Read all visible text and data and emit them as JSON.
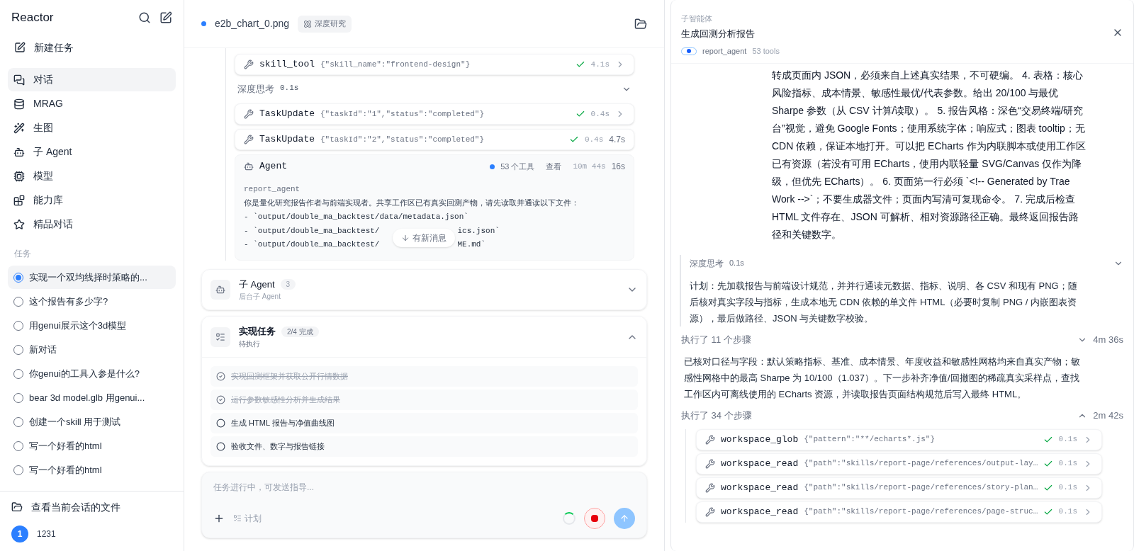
{
  "sidebar": {
    "brand": "Reactor",
    "new_task": "新建任务",
    "nav": [
      {
        "label": "对话",
        "kind": "chat",
        "selected": true
      },
      {
        "label": "MRAG",
        "kind": "database",
        "selected": false
      },
      {
        "label": "生图",
        "kind": "image",
        "selected": false
      },
      {
        "label": "子 Agent",
        "kind": "agent",
        "selected": false
      },
      {
        "label": "模型",
        "kind": "model",
        "selected": false
      },
      {
        "label": "能力库",
        "kind": "library",
        "selected": false
      },
      {
        "label": "精品对话",
        "kind": "featured",
        "selected": false
      }
    ],
    "tasks_heading": "任务",
    "tasks": [
      {
        "label": "实现一个双均线择时策略的...",
        "selected": true
      },
      {
        "label": "这个报告有多少字?",
        "selected": false
      },
      {
        "label": "用genui展示这个3d模型",
        "selected": false
      },
      {
        "label": "新对话",
        "selected": false
      },
      {
        "label": "你genui的工具入参是什么?",
        "selected": false
      },
      {
        "label": "bear 3d model.glb 用genui...",
        "selected": false
      },
      {
        "label": "创建一个skill 用于测试",
        "selected": false
      },
      {
        "label": "写一个好看的html",
        "selected": false
      },
      {
        "label": "写一个好看的html",
        "selected": false
      }
    ],
    "files_link": "查看当前会话的文件",
    "user": {
      "initial": "1",
      "name": "1231"
    }
  },
  "main": {
    "file": "e2b_chart_0.png",
    "mode_badge": "深度研究",
    "stream": [
      {
        "kind": "tool",
        "name": "skill_tool",
        "args": "{\"skill_name\":\"frontend-design\"}",
        "duration": "4.1s"
      },
      {
        "kind": "thinking",
        "label": "深度思考",
        "duration": "0.1s",
        "expanded": false
      },
      {
        "kind": "tool",
        "name": "TaskUpdate",
        "args": "{\"taskId\":\"1\",\"status\":\"completed\"}",
        "duration": "0.4s"
      },
      {
        "kind": "tool",
        "name": "TaskUpdate",
        "args": "{\"taskId\":\"2\",\"status\":\"completed\"}",
        "duration": "0.4s",
        "overlay": "4.7s"
      }
    ],
    "agent": {
      "title": "Agent",
      "tools": "53 个工具",
      "view": "查看",
      "elapsed": "10m 44s",
      "overlay": "16s",
      "agent_name": "report_agent",
      "prompt": "你是量化研究报告作者与前端实现者。共享工作区已有真实回测产物，请先读取并通读以下文件：",
      "lines": [
        {
          "before": "- `output/double_ma_backtest/data/metadata.json`"
        },
        {
          "before": "- `output/double_ma_backtest/",
          "after": "ics.json`"
        },
        {
          "before": "- `output/double_ma_backtest/",
          "after": "ME.md`"
        }
      ]
    },
    "new_messages": "有新消息",
    "subagents": {
      "title": "子 Agent",
      "count": "3",
      "subtitle": "后台子 Agent",
      "expanded": false
    },
    "todo": {
      "title": "实现任务",
      "progress": "2/4 完成",
      "subtitle": "待执行",
      "expanded": true,
      "items": [
        {
          "label": "实现回测框架并获取公开行情数据",
          "done": true
        },
        {
          "label": "运行参数敏感性分析并生成结果",
          "done": true
        },
        {
          "label": "生成 HTML 报告与净值曲线图",
          "done": false
        },
        {
          "label": "验收文件、数字与报告链接",
          "done": false
        }
      ]
    },
    "composer": {
      "placeholder": "任务进行中，可发送指导...",
      "plan": "计划"
    }
  },
  "panel": {
    "label": "子智能体",
    "title": "生成回测分析报告",
    "toggle_on": true,
    "agent": "report_agent",
    "tools": "53 tools",
    "message": "转成页面内 JSON，必须来自上述真实结果，不可硬编。 4. 表格：核心风险指标、成本情景、敏感性最优/代表参数。给出 20/100 与最优 Sharpe 参数（从 CSV 计算/读取）。 5. 报告风格：深色“交易终端/研究台”视觉，避免 Google Fonts；使用系统字体；响应式；图表 tooltip；无 CDN 依赖，保证本地打开。可以把 ECharts 作为内联脚本或使用工作区已有资源（若没有可用 ECharts，使用内联轻量 SVG/Canvas 仅作为降级，但优先 ECharts）。 6. 页面第一行必须 `<!-- Generated by Trae Work -->`；不要生成器文件；页面内写清可复现命令。 7. 完成后检查 HTML 文件存在、JSON 可解析、相对资源路径正确。最终返回报告路径和关键数字。",
    "thinking": {
      "label": "深度思考",
      "duration": "0.1s",
      "expanded": true,
      "text": "计划：先加载报告与前端设计规范，并并行通读元数据、指标、说明、各 CSV 和现有 PNG；随后核对真实字段与指标，生成本地无 CDN 依赖的单文件 HTML（必要时复制 PNG / 内嵌图表资源），最后做路径、JSON 与关键数字校验。"
    },
    "steps1": {
      "label": "执行了 11 个步骤",
      "duration": "4m 36s",
      "expanded": false
    },
    "summary": "已核对口径与字段：默认策略指标、基准、成本情景、年度收益和敏感性网格均来自真实产物；敏感性网格中的最高 Sharpe 为 10/100（1.037）。下一步补齐净值/回撤图的稀疏真实采样点，查找工作区内可离线使用的 ECharts 资源，并读取报告页面结构规范后写入最终 HTML。",
    "steps2": {
      "label": "执行了 34 个步骤",
      "duration": "2m 42s",
      "expanded": true,
      "tools": [
        {
          "name": "workspace_glob",
          "args": "{\"pattern\":\"**/echarts*.js\"}",
          "duration": "0.1s"
        },
        {
          "name": "workspace_read",
          "args": "{\"path\":\"skills/report-page/references/output-lay…",
          "duration": "0.1s"
        },
        {
          "name": "workspace_read",
          "args": "{\"path\":\"skills/report-page/references/story-plan…",
          "duration": "0.1s"
        },
        {
          "name": "workspace_read",
          "args": "{\"path\":\"skills/report-page/references/page-struc…",
          "duration": "0.1s"
        }
      ]
    }
  }
}
